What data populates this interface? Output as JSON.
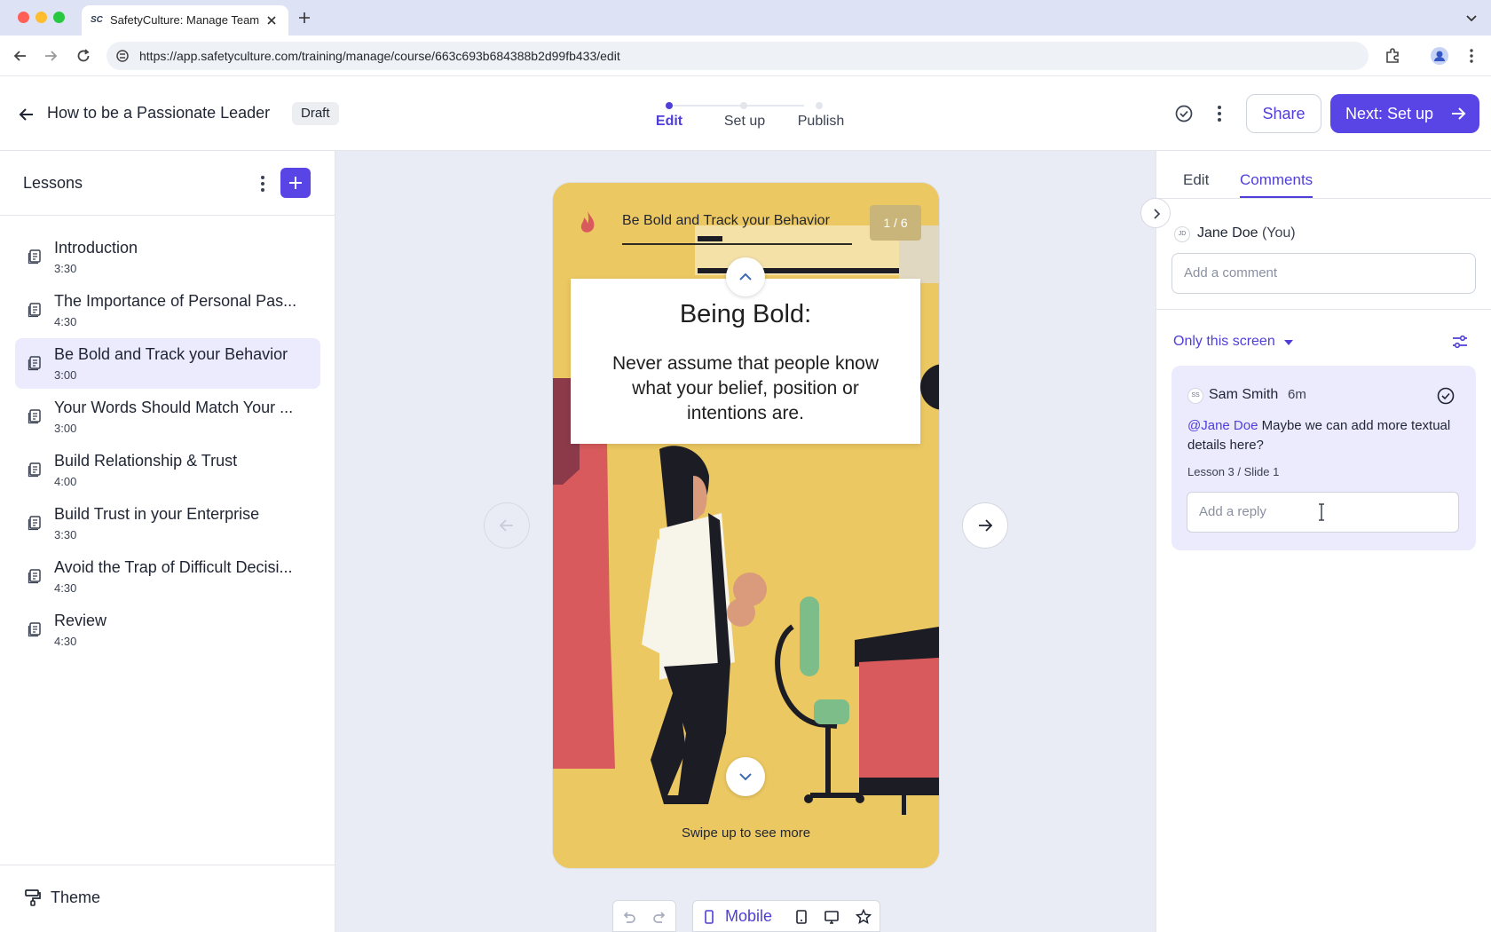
{
  "browser": {
    "tab_title": "SafetyCulture: Manage Teams",
    "tab_favicon": "SC",
    "url": "https://app.safetyculture.com/training/manage/course/663c693b684388b2d99fb433/edit"
  },
  "header": {
    "course_title": "How to be a Passionate Leader",
    "status_badge": "Draft",
    "steps": [
      {
        "label": "Edit",
        "active": true
      },
      {
        "label": "Set up",
        "active": false
      },
      {
        "label": "Publish",
        "active": false
      }
    ],
    "share_label": "Share",
    "next_label": "Next: Set up"
  },
  "sidebar": {
    "title": "Lessons",
    "lessons": [
      {
        "title": "Introduction",
        "duration": "3:30",
        "selected": false
      },
      {
        "title": "The Importance of Personal Pas...",
        "duration": "4:30",
        "selected": false
      },
      {
        "title": "Be Bold and Track your Behavior",
        "duration": "3:00",
        "selected": true
      },
      {
        "title": "Your Words Should Match Your ...",
        "duration": "3:00",
        "selected": false
      },
      {
        "title": "Build Relationship & Trust",
        "duration": "4:00",
        "selected": false
      },
      {
        "title": "Build Trust in your Enterprise",
        "duration": "3:30",
        "selected": false
      },
      {
        "title": "Avoid the Trap of Difficult Decisi...",
        "duration": "4:30",
        "selected": false
      },
      {
        "title": "Review",
        "duration": "4:30",
        "selected": false
      }
    ],
    "theme_label": "Theme"
  },
  "slide": {
    "header_title": "Be Bold and Track your Behavior",
    "counter": "1 / 6",
    "heading": "Being Bold:",
    "body": "Never assume that people know what your belief, position or intentions are.",
    "swipe_hint": "Swipe up to see more"
  },
  "preview_toolbar": {
    "mode_label": "Mobile"
  },
  "comments_panel": {
    "tabs": [
      {
        "label": "Edit",
        "active": false
      },
      {
        "label": "Comments",
        "active": true
      }
    ],
    "current_user": {
      "initials": "JD",
      "name": "Jane Doe",
      "suffix": "(You)"
    },
    "comment_placeholder": "Add a comment",
    "filter_label": "Only this screen",
    "comments": [
      {
        "initials": "SS",
        "author": "Sam Smith",
        "time": "6m",
        "mention": "@Jane Doe",
        "text": " Maybe we can add more textual details here?",
        "reference": "Lesson 3 / Slide 1",
        "reply_placeholder": "Add a reply"
      }
    ]
  },
  "colors": {
    "accent": "#5945e6",
    "accent_text": "#4f3fd8",
    "selected_bg": "#eceafd",
    "canvas_bg": "#e9ebf5",
    "slide_yellow": "#ecc862",
    "slide_red": "#d85a5c"
  },
  "icons": {
    "back": "arrow-left-icon",
    "more": "more-vertical-icon",
    "add": "plus-icon",
    "lesson": "lesson-page-icon",
    "theme": "paint-roller-icon",
    "check_circle": "check-circle-icon",
    "filter": "filter-sliders-icon"
  }
}
